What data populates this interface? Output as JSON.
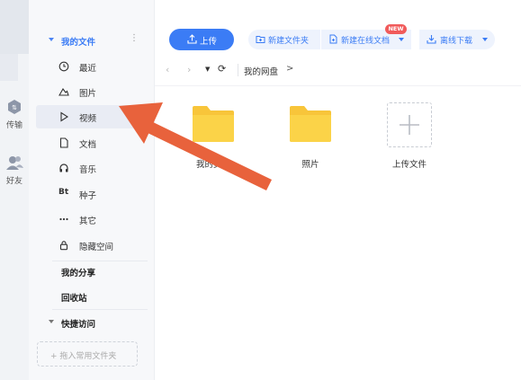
{
  "strip": {
    "transfer_label": "传输",
    "friends_label": "好友"
  },
  "sidebar": {
    "header_label": "我的文件",
    "items": [
      {
        "label": "最近",
        "icon": "clock-icon"
      },
      {
        "label": "图片",
        "icon": "mountain-icon"
      },
      {
        "label": "视频",
        "icon": "play-icon"
      },
      {
        "label": "文档",
        "icon": "document-icon"
      },
      {
        "label": "音乐",
        "icon": "headphones-icon"
      },
      {
        "label": "种子",
        "icon": "bt-icon"
      },
      {
        "label": "其它",
        "icon": "more-icon"
      },
      {
        "label": "隐藏空间",
        "icon": "lock-icon"
      }
    ],
    "bt_glyph": "Bt",
    "my_share": "我的分享",
    "recycle_bin": "回收站",
    "quick_access": "快捷访问",
    "add_quick_folder": "+ 拖入常用文件夹"
  },
  "toolbar": {
    "upload_label": "上传",
    "new_folder_label": "新建文件夹",
    "new_online_doc_label": "新建在线文档",
    "new_badge": "NEW",
    "offline_download_label": "离线下载"
  },
  "navbar": {
    "breadcrumb": "我的网盘",
    "crumb_separator": ">"
  },
  "files": [
    {
      "label": "我的资源",
      "type": "folder"
    },
    {
      "label": "照片",
      "type": "folder"
    },
    {
      "label": "上传文件",
      "type": "upload"
    }
  ],
  "colors": {
    "accent": "#3b7cf5",
    "folder": "#fbd348",
    "arrow": "#e8623c",
    "badge": "#f15b5b"
  }
}
